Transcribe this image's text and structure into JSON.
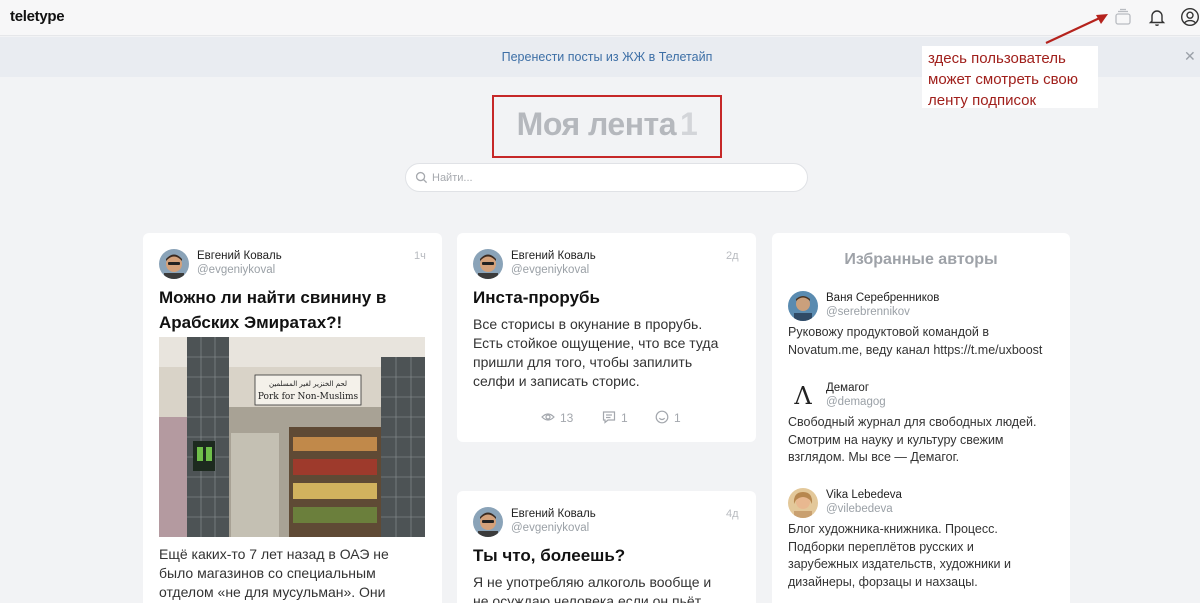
{
  "header": {
    "logo": "teletype",
    "icons": [
      "subscriptions-feed-icon",
      "bell-icon",
      "user-icon"
    ]
  },
  "banner": {
    "link": "Перенести посты из ЖЖ в Телетайп",
    "close_icon": "close-icon"
  },
  "annotation": {
    "lines": [
      "здесь пользователь",
      "может смотреть свою",
      "ленту подписок"
    ],
    "color": "#a0201c"
  },
  "page": {
    "title": "Моя лента",
    "count": "1"
  },
  "search": {
    "placeholder": "Найти..."
  },
  "posts": [
    {
      "author": "Евгений Коваль",
      "handle": "@evgeniykoval",
      "time": "1ч",
      "title_lines": [
        "Можно ли найти свинину в",
        "Арабских Эмиратах?!"
      ],
      "image_sign": "Pork for Non-Muslims",
      "text_lines": [
        "Ещё каких-то 7 лет назад в ОАЭ не",
        "было магазинов со специальным",
        "отделом «не для мусульман». Они"
      ]
    },
    {
      "author": "Евгений Коваль",
      "handle": "@evgeniykoval",
      "time": "2д",
      "title_lines": [
        "Инста-прорубь"
      ],
      "text_lines": [
        "Все сторисы в окунание в прорубь.",
        "Есть стойкое ощущение, что все туда",
        "пришли для того, чтобы запилить",
        "селфи и записать сторис."
      ],
      "stats": {
        "views": "13",
        "comments": "1",
        "reactions": "1"
      }
    },
    {
      "author": "Евгений Коваль",
      "handle": "@evgeniykoval",
      "time": "4д",
      "title_lines": [
        "Ты что, болеешь?"
      ],
      "text_lines": [
        "Я не употребляю алкоголь вообще и",
        "не осуждаю человека если он пьёт"
      ]
    }
  ],
  "sidebar": {
    "title": "Избранные авторы",
    "authors": [
      {
        "name": "Ваня Серебренников",
        "handle": "@serebrennikov",
        "desc_lines": [
          "Руковожу продуктовой командой в",
          "Novatum.me, веду канал https://t.me/uxboost"
        ]
      },
      {
        "name": "Демагог",
        "handle": "@demagog",
        "logo_letter": "Λ",
        "desc_lines": [
          "Свободный журнал для свободных людей.",
          "Смотрим на науку и культуру свежим",
          "взглядом. Мы все — Демагог."
        ]
      },
      {
        "name": "Vika Lebedeva",
        "handle": "@vilebedeva",
        "desc_lines": [
          "Блог художника-книжника. Процесс.",
          "Подборки переплётов русских и",
          "зарубежных издательств, художники и",
          "дизайнеры, форзацы и нахзацы."
        ]
      }
    ]
  }
}
